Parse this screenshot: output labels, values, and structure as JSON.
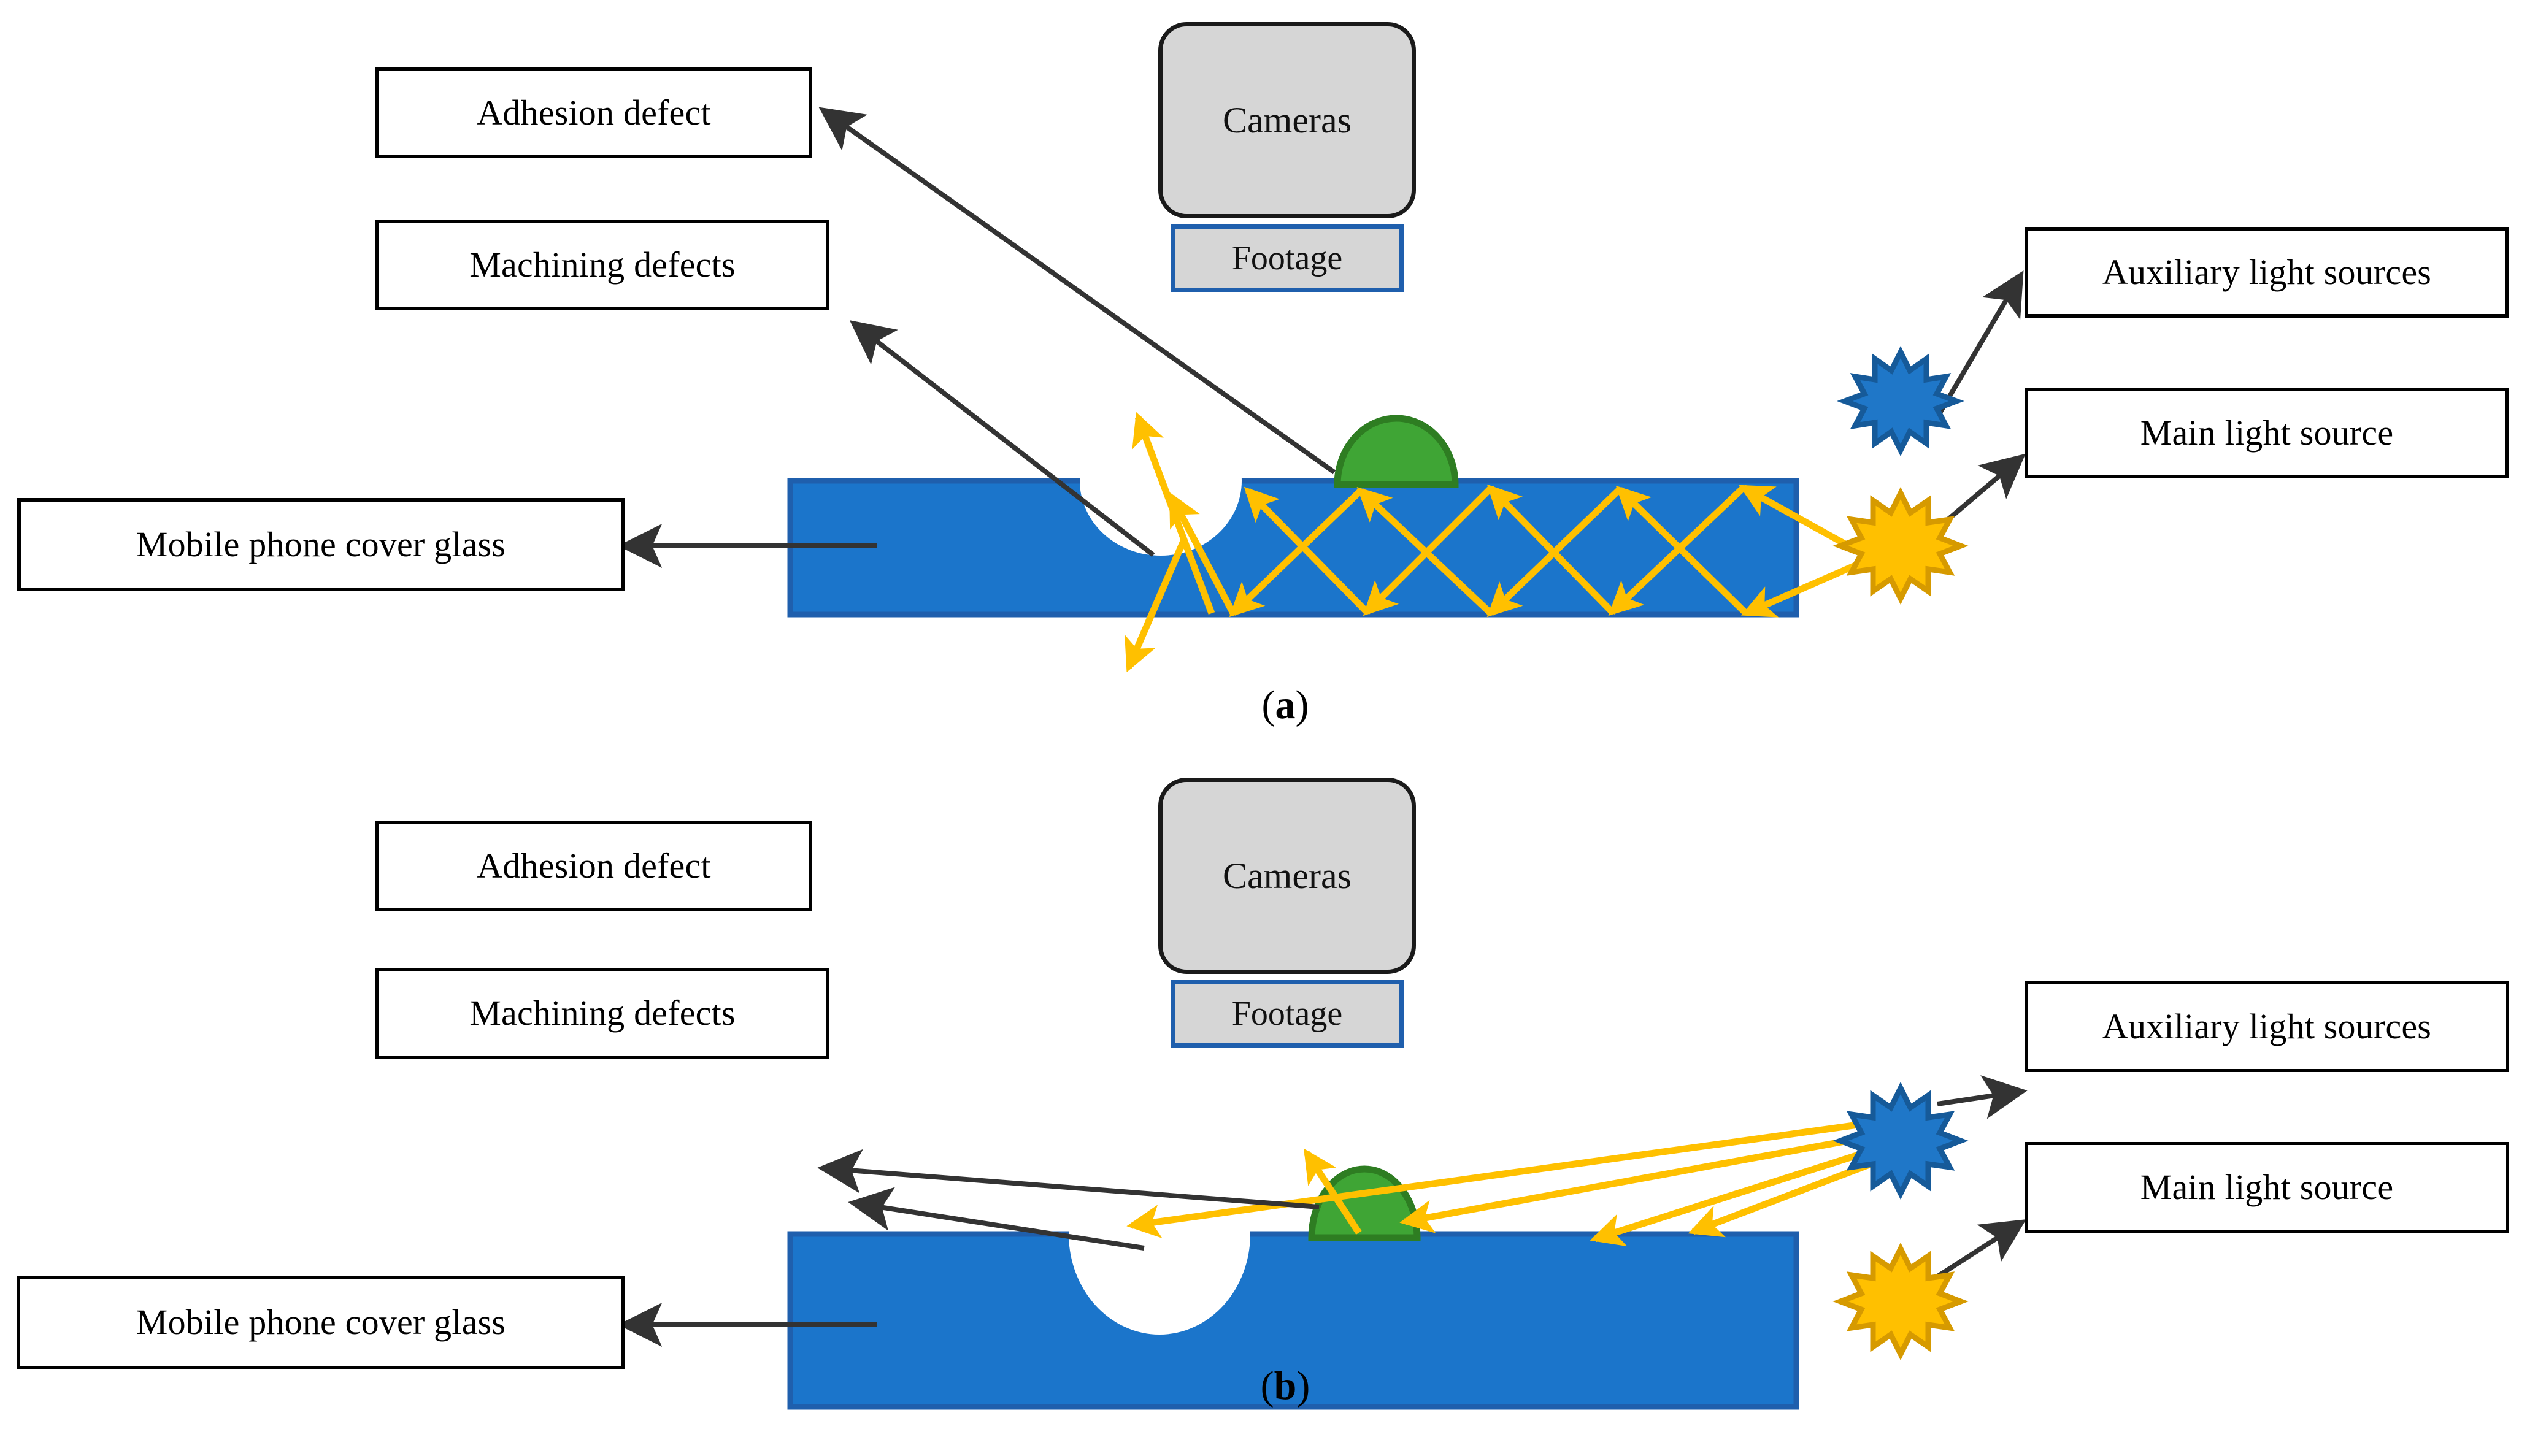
{
  "figure": {
    "type": "optical-inspection-schematic",
    "panels": [
      {
        "id": "a",
        "caption": "(a)",
        "caption_letter": "a",
        "lighting_mode": "main light source edge-coupled total internal reflection",
        "labels": {
          "adhesion_defect": "Adhesion defect",
          "machining_defects": "Machining defects",
          "cover_glass": "Mobile phone cover glass",
          "cameras": "Cameras",
          "footage": "Footage",
          "auxiliary_light": "Auxiliary light sources",
          "main_light": "Main light source"
        }
      },
      {
        "id": "b",
        "caption": "(b)",
        "caption_letter": "b",
        "lighting_mode": "auxiliary light source oblique surface illumination",
        "labels": {
          "adhesion_defect": "Adhesion defect",
          "machining_defects": "Machining defects",
          "cover_glass": "Mobile phone cover glass",
          "cameras": "Cameras",
          "footage": "Footage",
          "auxiliary_light": "Auxiliary light sources",
          "main_light": "Main light source"
        }
      }
    ],
    "colors": {
      "glass_fill": "#1B75CB",
      "glass_edge": "#1F5FAD",
      "adhesion_fill": "#3FA535",
      "adhesion_edge": "#2E7D22",
      "main_light_fill": "#FFC000",
      "main_light_edge": "#D69A00",
      "aux_light_fill": "#1F77C8",
      "aux_light_edge": "#165A99",
      "ray": "#FFC000",
      "leader": "#333333",
      "camera_fill": "#D6D6D6",
      "camera_edge": "#1A1A1A",
      "footage_edge": "#1F5FAD",
      "box_border": "#000000",
      "background": "#FFFFFF"
    },
    "icons": {
      "adhesion_defect": "green-dome-icon",
      "machining_defect": "notch-icon",
      "main_light": "yellow-starburst-icon",
      "aux_light": "blue-starburst-icon",
      "camera": "camera-module-icon",
      "ray": "light-ray-arrow-icon",
      "leader": "leader-arrow-icon"
    }
  }
}
